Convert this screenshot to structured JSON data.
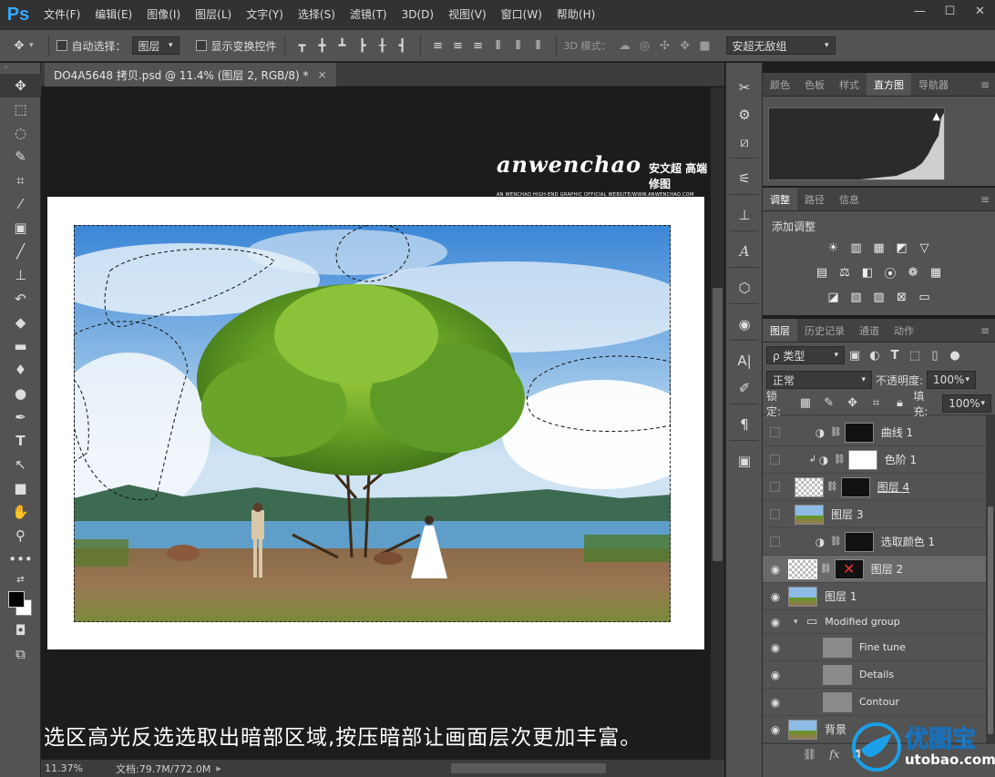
{
  "app": {
    "logo": "Ps"
  },
  "menu": [
    "文件(F)",
    "编辑(E)",
    "图像(I)",
    "图层(L)",
    "文字(Y)",
    "选择(S)",
    "滤镜(T)",
    "3D(D)",
    "视图(V)",
    "窗口(W)",
    "帮助(H)"
  ],
  "options": {
    "auto_select_label": "自动选择：",
    "auto_select_value": "图层",
    "show_transform_label": "显示变换控件",
    "mode_3d_label": "3D 模式：",
    "workspace": "安超无敌组"
  },
  "document": {
    "tab_title": "DO4A5648 拷贝.psd @ 11.4% (图层 2, RGB/8) *",
    "logo_text": "anwenchao",
    "logo_cn": "安文超 高端修图",
    "logo_sub": "AN WENCHAO HIGH-END GRAPHIC OFFICIAL WEBSITE/WWW.ANWENCHAO.COM",
    "caption": "选区高光反选选取出暗部区域,按压暗部让画面层次更加丰富。"
  },
  "status": {
    "zoom": "11.37%",
    "doc_size": "文档:79.7M/772.0M"
  },
  "panels": {
    "top_tabs": [
      "颜色",
      "色板",
      "样式",
      "直方图",
      "导航器"
    ],
    "top_active": 3,
    "adjust_tabs": [
      "调整",
      "路径",
      "信息"
    ],
    "adjust_title": "添加调整",
    "layers_tabs": [
      "图层",
      "历史记录",
      "通道",
      "动作"
    ],
    "filter_label": "ρ 类型",
    "blend_mode": "正常",
    "opacity_label": "不透明度:",
    "opacity": "100%",
    "lock_label": "锁定:",
    "fill_label": "填充:",
    "fill": "100%"
  },
  "layers": [
    {
      "name": "曲线 1",
      "visible": false
    },
    {
      "name": "色阶 1",
      "visible": false
    },
    {
      "name": "图层 4",
      "visible": false
    },
    {
      "name": "图层 3",
      "visible": false
    },
    {
      "name": "选取颜色 1",
      "visible": false
    },
    {
      "name": "图层 2",
      "visible": true,
      "selected": true
    },
    {
      "name": "图层 1",
      "visible": true
    },
    {
      "name": "Modified group",
      "visible": true
    },
    {
      "name": "Fine tune",
      "visible": true
    },
    {
      "name": "Details",
      "visible": true
    },
    {
      "name": "Contour",
      "visible": true
    },
    {
      "name": "背景",
      "visible": true
    }
  ],
  "watermark": {
    "brand": "优图宝",
    "url": "utobao.com"
  },
  "colors": {
    "accent": "#31a8ff",
    "panel": "#535353",
    "dark": "#323232",
    "canvas": "#1c1c1c"
  }
}
